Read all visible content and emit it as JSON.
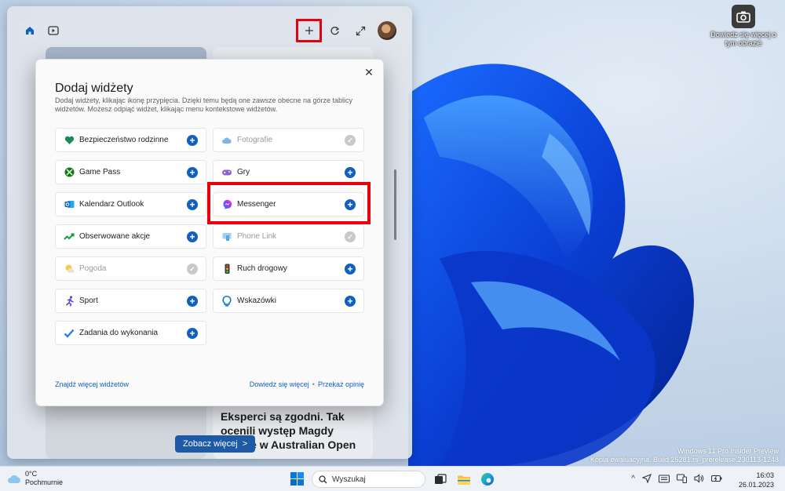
{
  "desktop": {
    "icon_label": "Dowiedz się więcej o tym obrazie",
    "watermark_line1": "Windows 11 Pro Insider Preview",
    "watermark_line2": "Kopia ewaluacyjna. Build 25281.rs_prerelease.230113-1248"
  },
  "board": {
    "news_headline": "Eksperci są zgodni. Tak ocenili występ Magdy Linette w Australian Open",
    "see_more_label": "Zobacz więcej",
    "see_more_arrow": ">"
  },
  "dialog": {
    "close_glyph": "✕",
    "title": "Dodaj widżety",
    "description": "Dodaj widżety, klikając ikonę przypięcia. Dzięki temu będą one zawsze obecne na górze tablicy widżetów. Możesz odpiąć widżet, klikając menu kontekstowe widżetów.",
    "find_more_link": "Znajdź więcej widżetów",
    "learn_more_link": "Dowiedz się więcej",
    "link_separator": "•",
    "feedback_link": "Przekaż opinię",
    "widgets": [
      {
        "label": "Bezpieczeństwo rodzinne",
        "icon": "heart-shield-icon",
        "color": "#1c8a5c",
        "added": false
      },
      {
        "label": "Fotografie",
        "icon": "cloud-icon",
        "color": "#7fb3e6",
        "added": true
      },
      {
        "label": "Game Pass",
        "icon": "xbox-icon",
        "color": "#107c10",
        "added": false
      },
      {
        "label": "Gry",
        "icon": "gamepad-icon",
        "color": "#8a63d2",
        "added": false
      },
      {
        "label": "Kalendarz Outlook",
        "icon": "outlook-icon",
        "color": "#0f6cbd",
        "added": false
      },
      {
        "label": "Messenger",
        "icon": "messenger-icon",
        "color": "#7a45f5",
        "added": false
      },
      {
        "label": "Obserwowane akcje",
        "icon": "stocks-icon",
        "color": "#1a9c3a",
        "added": false
      },
      {
        "label": "Phone Link",
        "icon": "phone-link-icon",
        "color": "#58a6e0",
        "added": true
      },
      {
        "label": "Pogoda",
        "icon": "sun-cloud-icon",
        "color": "#f2b51f",
        "added": true
      },
      {
        "label": "Ruch drogowy",
        "icon": "traffic-light-icon",
        "color": "#3a7d2a",
        "added": false
      },
      {
        "label": "Sport",
        "icon": "runner-icon",
        "color": "#5a4bd6",
        "added": false
      },
      {
        "label": "Wskazówki",
        "icon": "lightbulb-icon",
        "color": "#1b7ed4",
        "added": false
      },
      {
        "label": "Zadania do wykonania",
        "icon": "checkmark-icon",
        "color": "#2d7be8",
        "added": false
      }
    ],
    "add_glyph": "+",
    "added_glyph": "✓"
  },
  "taskbar": {
    "temperature": "0°C",
    "condition": "Pochmurnie",
    "search_placeholder": "Wyszukaj",
    "tray_chevron": "^",
    "time": "16:03",
    "date": "26.01.2023"
  },
  "colors": {
    "accent": "#1160c0",
    "highlight_red": "#e8000b"
  }
}
